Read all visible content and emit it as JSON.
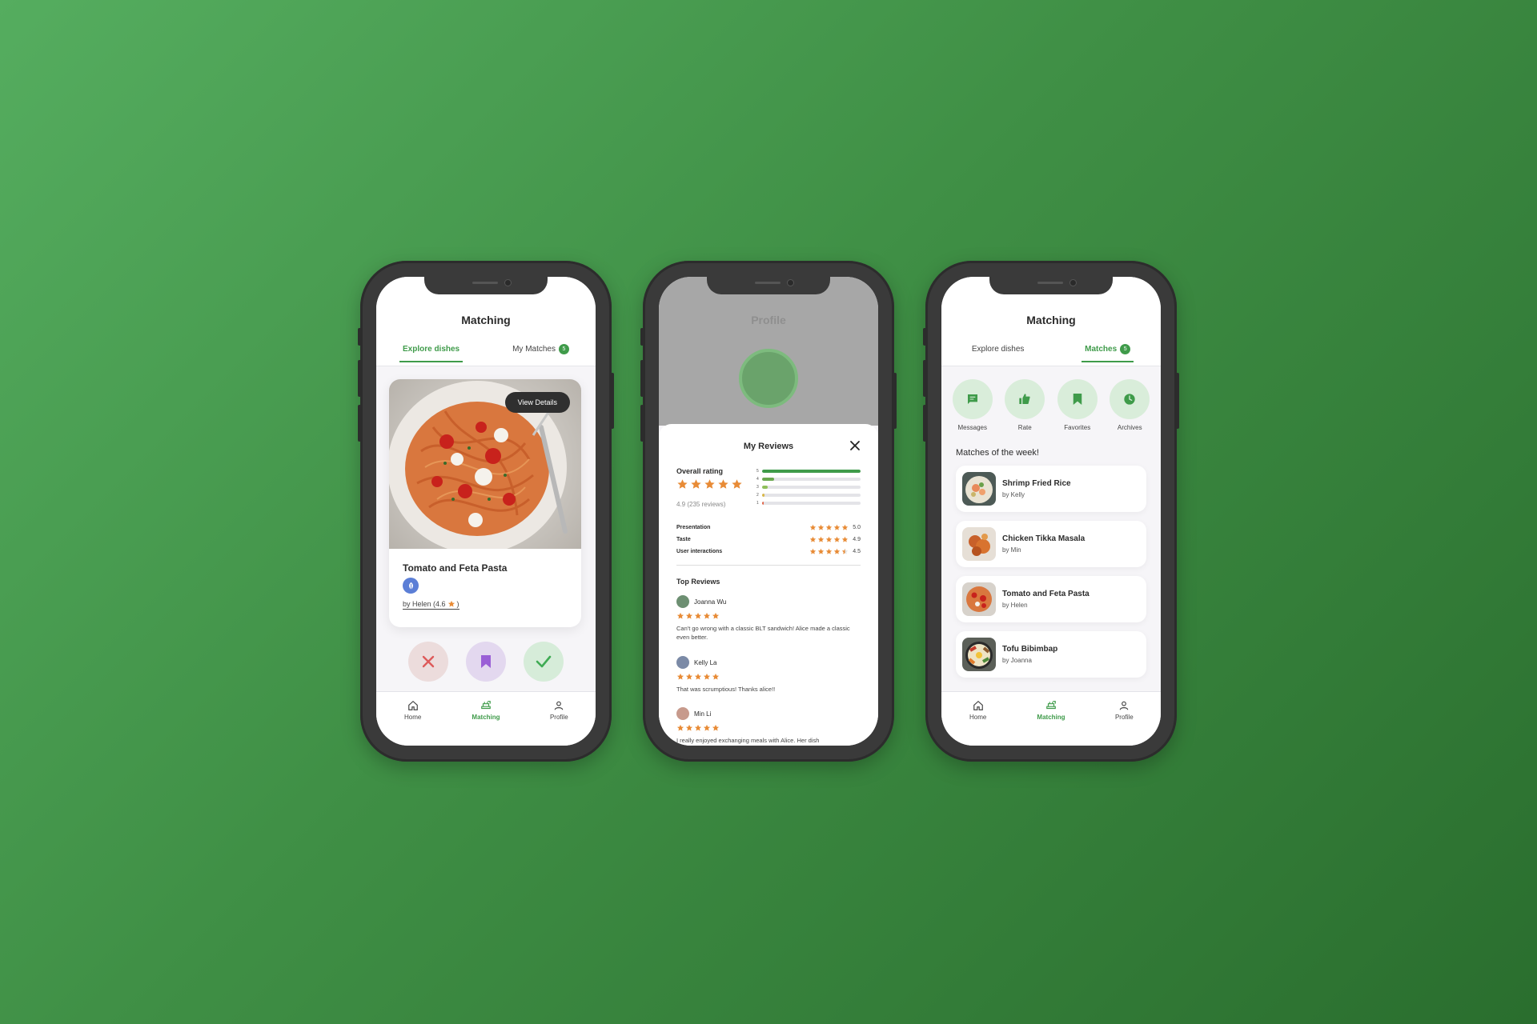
{
  "colors": {
    "accent": "#3f9b4a",
    "star": "#e88b36",
    "background": "#4a9b50"
  },
  "bottom_nav": [
    {
      "label": "Home",
      "icon": "home-icon"
    },
    {
      "label": "Matching",
      "icon": "dishes-icon"
    },
    {
      "label": "Profile",
      "icon": "user-icon"
    }
  ],
  "phone1": {
    "title": "Matching",
    "tabs": [
      {
        "label": "Explore dishes",
        "active": true
      },
      {
        "label": "My Matches",
        "badge": "5"
      }
    ],
    "card": {
      "view_details": "View Details",
      "dish_name": "Tomato and Feta Pasta",
      "author_text": "by Helen (4.6",
      "author_close": ")",
      "diet_icon": "vegetarian-icon"
    },
    "actions": [
      {
        "name": "reject",
        "icon": "x-icon"
      },
      {
        "name": "save",
        "icon": "bookmark-icon"
      },
      {
        "name": "accept",
        "icon": "check-icon"
      }
    ]
  },
  "phone2": {
    "background_title": "Profile",
    "sheet_title": "My Reviews",
    "overall_label": "Overall rating",
    "overall_value": 4.9,
    "reviews_count_text": "4.9 (235 reviews)",
    "distribution": [
      {
        "star": "5",
        "fraction": 1.0
      },
      {
        "star": "4",
        "fraction": 0.12
      },
      {
        "star": "3",
        "fraction": 0.06
      },
      {
        "star": "2",
        "fraction": 0.03
      },
      {
        "star": "1",
        "fraction": 0.02
      }
    ],
    "criteria": [
      {
        "label": "Presentation",
        "score": "5.0",
        "value": 5.0
      },
      {
        "label": "Taste",
        "score": "4.9",
        "value": 4.9
      },
      {
        "label": "User interactions",
        "score": "4.5",
        "value": 4.5
      }
    ],
    "top_reviews_label": "Top Reviews",
    "reviews": [
      {
        "name": "Joanna Wu",
        "stars": 5,
        "text": "Can't go wrong with a classic BLT sandwich! Alice made a classic even better."
      },
      {
        "name": "Kelly La",
        "stars": 5,
        "text": "That was scrumptious! Thanks alice!!"
      },
      {
        "name": "Min Li",
        "stars": 5,
        "text": "I really enjoyed exchanging meals with Alice. Her dish"
      }
    ]
  },
  "phone3": {
    "title": "Matching",
    "tabs": [
      {
        "label": "Explore dishes"
      },
      {
        "label": "Matches",
        "badge": "5",
        "active": true
      }
    ],
    "quick_actions": [
      {
        "label": "Messages",
        "icon": "message-icon"
      },
      {
        "label": "Rate",
        "icon": "thumbs-up-icon"
      },
      {
        "label": "Favorites",
        "icon": "bookmark-icon"
      },
      {
        "label": "Archives",
        "icon": "clock-icon"
      }
    ],
    "section_title": "Matches of the week!",
    "matches": [
      {
        "name": "Shrimp Fried Rice",
        "by": "by Kelly"
      },
      {
        "name": "Chicken Tikka Masala",
        "by": "by Min"
      },
      {
        "name": "Tomato and Feta Pasta",
        "by": "by Helen"
      },
      {
        "name": "Tofu Bibimbap",
        "by": "by Joanna"
      }
    ]
  }
}
